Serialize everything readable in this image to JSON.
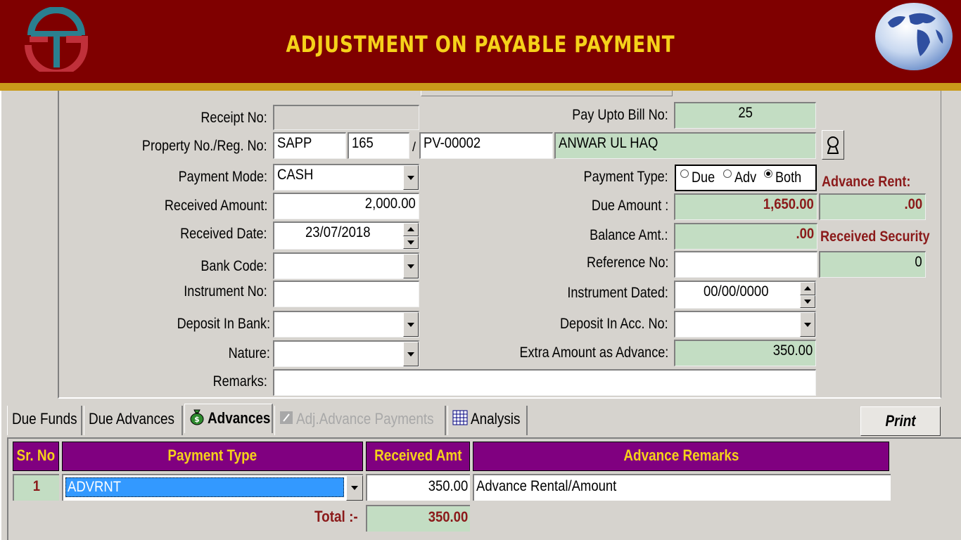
{
  "banner": {
    "title": "ADJUSTMENT ON PAYABLE PAYMENT",
    "colors": {
      "background": "#7f0000",
      "stripe": "#c99a1a",
      "title": "#f5d21a"
    }
  },
  "form": {
    "receipt_no": {
      "label": "Receipt No:",
      "value": ""
    },
    "pay_upto_bill_no": {
      "label": "Pay Upto Bill No:",
      "value": "25"
    },
    "property": {
      "label": "Property No./Reg. No:",
      "code": "SAPP",
      "number": "165",
      "separator": "/",
      "reg_no": "PV-00002",
      "owner_name": "ANWAR UL HAQ"
    },
    "payment_mode": {
      "label": "Payment Mode:",
      "value": "CASH"
    },
    "payment_type": {
      "label": "Payment Type:",
      "options": [
        "Due",
        "Adv",
        "Both"
      ],
      "selected": "Both"
    },
    "advance_rent": {
      "label": "Advance Rent:",
      "value": ".00"
    },
    "received_amount": {
      "label": "Received Amount:",
      "value": "2,000.00"
    },
    "due_amount": {
      "label": "Due Amount :",
      "value": "1,650.00"
    },
    "received_date": {
      "label": "Received Date:",
      "value": "23/07/2018"
    },
    "balance_amt": {
      "label": "Balance Amt.:",
      "value": ".00"
    },
    "received_security": {
      "label": "Received Security",
      "value": "0"
    },
    "bank_code": {
      "label": "Bank Code:",
      "value": ""
    },
    "reference_no": {
      "label": "Reference No:",
      "value": ""
    },
    "instrument_no": {
      "label": "Instrument No:",
      "value": ""
    },
    "instrument_dated": {
      "label": "Instrument Dated:",
      "value": "00/00/0000"
    },
    "deposit_in_bank": {
      "label": "Deposit In Bank:",
      "value": ""
    },
    "deposit_in_acc_no": {
      "label": "Deposit In Acc. No:",
      "value": ""
    },
    "nature": {
      "label": "Nature:",
      "value": ""
    },
    "extra_amount_advance": {
      "label": "Extra Amount as Advance:",
      "value": "350.00"
    },
    "remarks": {
      "label": "Remarks:",
      "value": ""
    }
  },
  "tabs": [
    {
      "label": "Due Funds",
      "icon": "",
      "state": "normal"
    },
    {
      "label": "Due Advances",
      "icon": "",
      "state": "normal"
    },
    {
      "label": "Advances",
      "icon": "money-bag-icon",
      "state": "active"
    },
    {
      "label": "Adj.Advance Payments",
      "icon": "edit-icon",
      "state": "disabled"
    },
    {
      "label": "Analysis",
      "icon": "grid-icon",
      "state": "normal"
    }
  ],
  "print_button": "Print",
  "grid": {
    "headers": [
      "Sr. No",
      "Payment Type",
      "Received Amt",
      "Advance Remarks"
    ],
    "rows": [
      {
        "sr_no": "1",
        "payment_type": "ADVRNT",
        "received_amt": "350.00",
        "remarks": "Advance Rental/Amount"
      }
    ],
    "total_label": "Total :-",
    "total_value": "350.00",
    "colors": {
      "header_bg": "#800080",
      "header_text": "#f5d21a",
      "selected": "#3399ff",
      "green": "#c3ddc3"
    }
  }
}
